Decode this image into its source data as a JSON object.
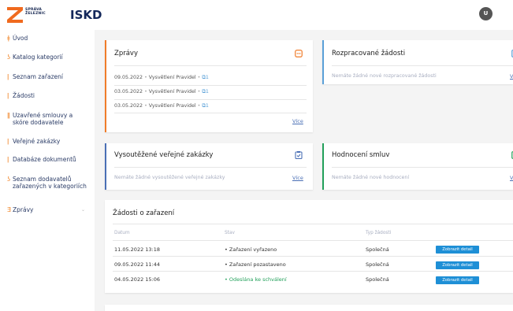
{
  "header": {
    "logo_small_line1": "SPRÁVA",
    "logo_small_line2": "ŽELEZNIC",
    "logo_text": "ISKD",
    "avatar_initial": "U"
  },
  "sidebar": {
    "items": [
      {
        "label": "Úvod",
        "icon": "home-icon"
      },
      {
        "label": "Katalog kategorií",
        "icon": "catalog-icon"
      },
      {
        "label": "Seznam zařazení",
        "icon": "list-icon"
      },
      {
        "label": "Žádosti",
        "icon": "requests-icon"
      },
      {
        "label": "Uzavřené smlouvy a skóre dodavatele",
        "icon": "contract-icon"
      },
      {
        "label": "Veřejné zakázky",
        "icon": "tender-icon"
      },
      {
        "label": "Databáze dokumentů",
        "icon": "documents-icon"
      },
      {
        "label": "Seznam dodavatelů zařazených v kategoriích",
        "icon": "suppliers-icon"
      },
      {
        "label": "Zprávy",
        "icon": "messages-icon",
        "chevron": "⌄"
      }
    ]
  },
  "cards": {
    "zpravy": {
      "title": "Zprávy",
      "rows": [
        {
          "date": "09.05.2022",
          "text": "Vysvětlení Pravidel",
          "count": "1"
        },
        {
          "date": "03.05.2022",
          "text": "Vysvětlení Pravidel",
          "count": "1"
        },
        {
          "date": "03.05.2022",
          "text": "Vysvětlení Pravidel",
          "count": "1"
        }
      ],
      "link": "Více",
      "accent": "#f07c2a"
    },
    "rozpracovane": {
      "title": "Rozpracované žádosti",
      "empty": "Nemáte žádné nové rozpracované žádosti",
      "link": "V",
      "accent": "#5aa0d8"
    },
    "vysoutezene": {
      "title": "Vysoutěžené veřejné zakázky",
      "empty": "Nemáte žádné vysoutěžené veřejné zakázky",
      "link": "Více",
      "accent": "#4a6fb5"
    },
    "hodnoceni": {
      "title": "Hodnocení smluv",
      "empty": "Nemáte žádné nové hodnocení",
      "link": "V",
      "accent": "#22a05a"
    }
  },
  "zadosti": {
    "title": "Žádosti o zařazení",
    "columns": [
      "Datum",
      "Stav",
      "Typ žádosti"
    ],
    "rows": [
      {
        "date": "11.05.2022 13:18",
        "status": "• Zařazení vyřazeno",
        "type": "Společná",
        "button": "Zobrazit detail",
        "status_color": "normal"
      },
      {
        "date": "09.05.2022 11:44",
        "status": "• Zařazení pozastaveno",
        "type": "Společná",
        "button": "Zobrazit detail",
        "status_color": "normal"
      },
      {
        "date": "04.05.2022 15:06",
        "status": "• Odeslána ke schválení",
        "type": "Společná",
        "button": "Zobrazit detail",
        "status_color": "green"
      }
    ]
  }
}
